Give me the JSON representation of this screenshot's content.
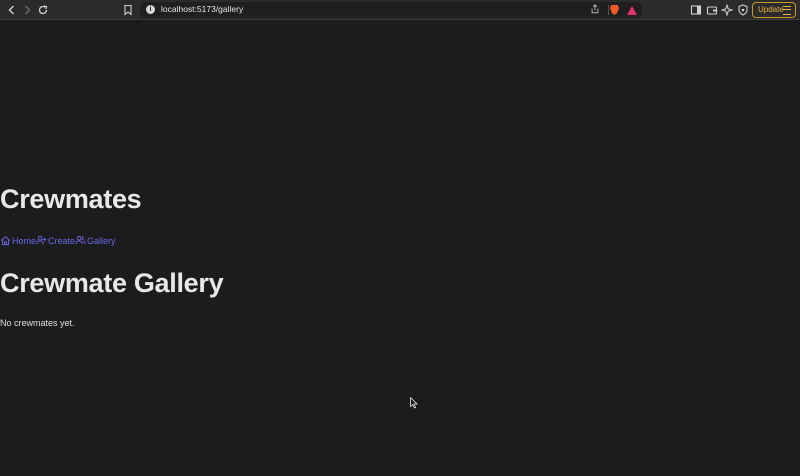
{
  "browser": {
    "url": "localhost:5173/gallery",
    "update_label": "Update"
  },
  "header": {
    "title": "Crewmates"
  },
  "nav": {
    "items": [
      {
        "label": "Home",
        "icon": "home-icon"
      },
      {
        "label": "Create",
        "icon": "user-plus-icon"
      },
      {
        "label": "Gallery",
        "icon": "users-icon"
      }
    ]
  },
  "main": {
    "title": "Crewmate Gallery",
    "empty_message": "No crewmates yet."
  },
  "colors": {
    "background": "#1c1c1e",
    "link": "#6b68e8",
    "update_accent": "#e5b53a"
  }
}
